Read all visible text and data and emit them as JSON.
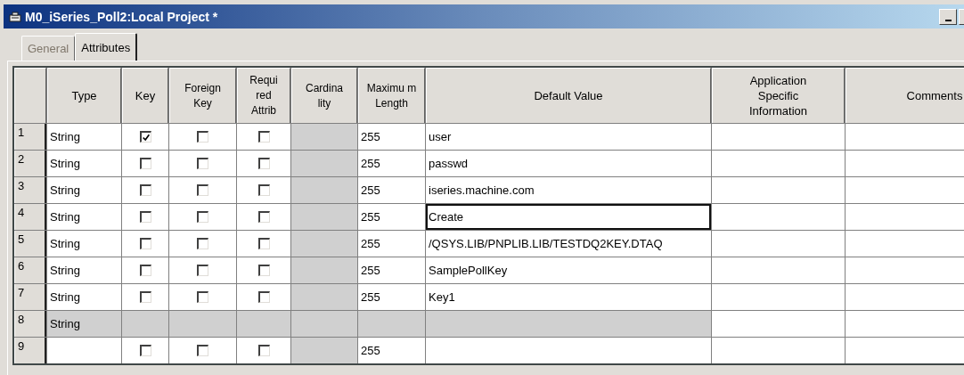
{
  "window": {
    "title": "M0_iSeries_Poll2:Local Project *"
  },
  "tabs": [
    {
      "label": "General",
      "selected": false
    },
    {
      "label": "Attributes",
      "selected": true
    }
  ],
  "table": {
    "columns": [
      "",
      "Type",
      "Key",
      "Foreign Key",
      "Requi red Attrib",
      "Cardina lity",
      "Maximu m Length",
      "Default Value",
      "Application Specific Information",
      "Comments"
    ],
    "rows": [
      {
        "number": "1",
        "type": "String",
        "key": true,
        "foreign_key": false,
        "required": false,
        "max_length": "255",
        "default_value": "user",
        "focused": false,
        "disabled": false
      },
      {
        "number": "2",
        "type": "String",
        "key": false,
        "foreign_key": false,
        "required": false,
        "max_length": "255",
        "default_value": "passwd",
        "focused": false,
        "disabled": false
      },
      {
        "number": "3",
        "type": "String",
        "key": false,
        "foreign_key": false,
        "required": false,
        "max_length": "255",
        "default_value": "iseries.machine.com",
        "focused": false,
        "disabled": false
      },
      {
        "number": "4",
        "type": "String",
        "key": false,
        "foreign_key": false,
        "required": false,
        "max_length": "255",
        "default_value": "Create",
        "focused": true,
        "disabled": false
      },
      {
        "number": "5",
        "type": "String",
        "key": false,
        "foreign_key": false,
        "required": false,
        "max_length": "255",
        "default_value": "/QSYS.LIB/PNPLIB.LIB/TESTDQ2KEY.DTAQ",
        "focused": false,
        "disabled": false
      },
      {
        "number": "6",
        "type": "String",
        "key": false,
        "foreign_key": false,
        "required": false,
        "max_length": "255",
        "default_value": "SamplePollKey",
        "focused": false,
        "disabled": false
      },
      {
        "number": "7",
        "type": "String",
        "key": false,
        "foreign_key": false,
        "required": false,
        "max_length": "255",
        "default_value": "Key1",
        "focused": false,
        "disabled": false
      },
      {
        "number": "8",
        "type": "String",
        "focused": false,
        "disabled": true
      },
      {
        "number": "9",
        "key": false,
        "foreign_key": false,
        "required": false,
        "max_length": "255",
        "focused": false,
        "disabled": false
      }
    ]
  }
}
